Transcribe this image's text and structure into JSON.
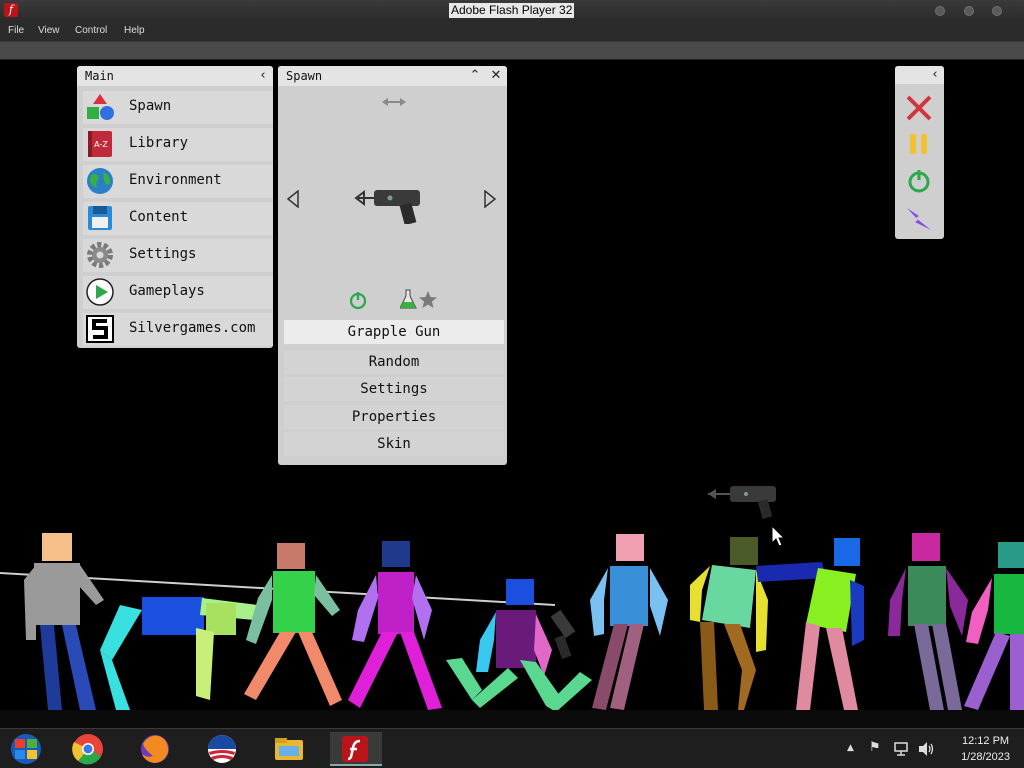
{
  "window": {
    "title": "Adobe Flash Player 32"
  },
  "menubar": {
    "items": [
      "File",
      "View",
      "Control",
      "Help"
    ]
  },
  "main_panel": {
    "title": "Main",
    "items": [
      {
        "label": "Spawn",
        "icon": "shapes-icon"
      },
      {
        "label": "Library",
        "icon": "book-az-icon"
      },
      {
        "label": "Environment",
        "icon": "globe-icon"
      },
      {
        "label": "Content",
        "icon": "floppy-disk-icon"
      },
      {
        "label": "Settings",
        "icon": "gear-icon"
      },
      {
        "label": "Gameplays",
        "icon": "play-icon"
      },
      {
        "label": "Silvergames.com",
        "icon": "silvergames-logo-icon"
      }
    ]
  },
  "spawn_panel": {
    "title": "Spawn",
    "selected_item": "Grapple Gun",
    "buttons": [
      "Random",
      "Settings",
      "Properties",
      "Skin"
    ]
  },
  "taskbar": {
    "time": "12:12 PM",
    "date": "1/28/2023"
  },
  "colors": {
    "panel_bg": "#cfcfcf",
    "header_bg": "#e4e4e4",
    "close_red": "#d0343c",
    "pause_yellow": "#f2c230",
    "power_green": "#2aa84a",
    "lightning_purple": "#8a4de8"
  }
}
